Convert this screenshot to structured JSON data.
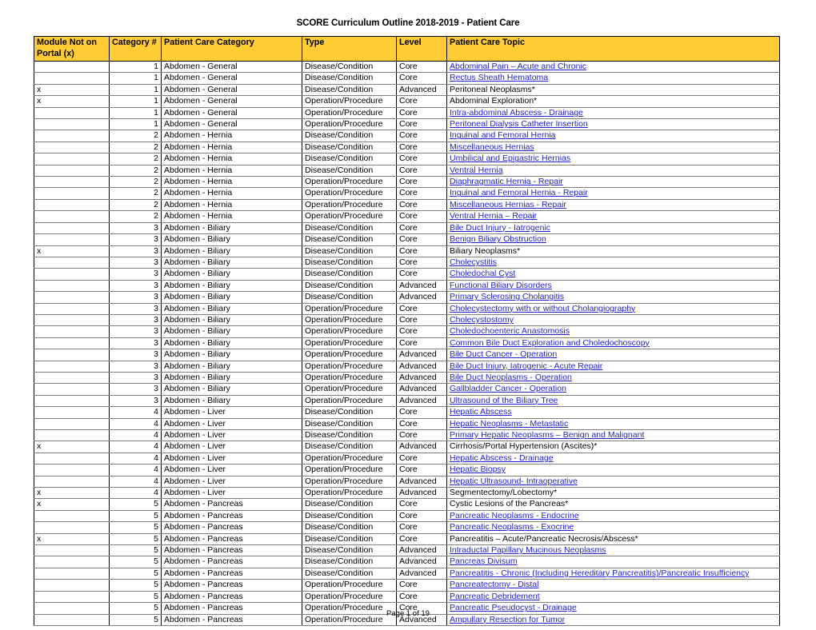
{
  "document": {
    "title": "SCORE Curriculum Outline 2018-2019 - Patient Care",
    "footer": "Page 1 of 19",
    "header_bg_color": "#FFCC33",
    "link_color": "#2222CC"
  },
  "table": {
    "columns": [
      {
        "key": "module_not_on_portal",
        "label": "Module Not on Portal (x)"
      },
      {
        "key": "category_number",
        "label": "Category #"
      },
      {
        "key": "patient_care_category",
        "label": "Patient Care Category"
      },
      {
        "key": "type",
        "label": "Type"
      },
      {
        "key": "level",
        "label": "Level"
      },
      {
        "key": "patient_care_topic",
        "label": "Patient Care Topic"
      }
    ],
    "rows": [
      {
        "mod": "",
        "cat": "1",
        "category": "Abdomen - General",
        "type": "Disease/Condition",
        "level": "Core",
        "topic": "Abdominal Pain – Acute and Chronic",
        "link": true
      },
      {
        "mod": "",
        "cat": "1",
        "category": "Abdomen - General",
        "type": "Disease/Condition",
        "level": "Core",
        "topic": "Rectus Sheath Hematoma",
        "link": true
      },
      {
        "mod": "x",
        "cat": "1",
        "category": "Abdomen - General",
        "type": "Disease/Condition",
        "level": "Advanced",
        "topic": "Peritoneal Neoplasms*",
        "link": false
      },
      {
        "mod": "x",
        "cat": "1",
        "category": "Abdomen - General",
        "type": "Operation/Procedure",
        "level": "Core",
        "topic": "Abdominal Exploration*",
        "link": false
      },
      {
        "mod": "",
        "cat": "1",
        "category": "Abdomen - General",
        "type": "Operation/Procedure",
        "level": "Core",
        "topic": "Intra-abdominal Abscess - Drainage",
        "link": true
      },
      {
        "mod": "",
        "cat": "1",
        "category": "Abdomen - General",
        "type": "Operation/Procedure",
        "level": "Core",
        "topic": "Peritoneal Dialysis Catheter Insertion",
        "link": true
      },
      {
        "mod": "",
        "cat": "2",
        "category": "Abdomen - Hernia",
        "type": "Disease/Condition",
        "level": "Core",
        "topic": "Inguinal and Femoral Hernia",
        "link": true
      },
      {
        "mod": "",
        "cat": "2",
        "category": "Abdomen - Hernia",
        "type": "Disease/Condition",
        "level": "Core",
        "topic": "Miscellaneous Hernias",
        "link": true
      },
      {
        "mod": "",
        "cat": "2",
        "category": "Abdomen - Hernia",
        "type": "Disease/Condition",
        "level": "Core",
        "topic": "Umbilical and Epigastric Hernias",
        "link": true
      },
      {
        "mod": "",
        "cat": "2",
        "category": "Abdomen - Hernia",
        "type": "Disease/Condition",
        "level": "Core",
        "topic": "Ventral Hernia",
        "link": true
      },
      {
        "mod": "",
        "cat": "2",
        "category": "Abdomen - Hernia",
        "type": "Operation/Procedure",
        "level": "Core",
        "topic": "Diaphragmatic Hernia - Repair",
        "link": true
      },
      {
        "mod": "",
        "cat": "2",
        "category": "Abdomen - Hernia",
        "type": "Operation/Procedure",
        "level": "Core",
        "topic": "Inguinal and Femoral Hernia - Repair",
        "link": true
      },
      {
        "mod": "",
        "cat": "2",
        "category": "Abdomen - Hernia",
        "type": "Operation/Procedure",
        "level": "Core",
        "topic": "Miscellaneous Hernias - Repair",
        "link": true
      },
      {
        "mod": "",
        "cat": "2",
        "category": "Abdomen - Hernia",
        "type": "Operation/Procedure",
        "level": "Core",
        "topic": "Ventral Hernia – Repair",
        "link": true
      },
      {
        "mod": "",
        "cat": "3",
        "category": "Abdomen - Biliary",
        "type": "Disease/Condition",
        "level": "Core",
        "topic": "Bile Duct Injury - Iatrogenic",
        "link": true
      },
      {
        "mod": "",
        "cat": "3",
        "category": "Abdomen - Biliary",
        "type": "Disease/Condition",
        "level": "Core",
        "topic": "Benign Biliary Obstruction",
        "link": true
      },
      {
        "mod": "x",
        "cat": "3",
        "category": "Abdomen - Biliary",
        "type": "Disease/Condition",
        "level": "Core",
        "topic": "Biliary Neoplasms*",
        "link": false
      },
      {
        "mod": "",
        "cat": "3",
        "category": "Abdomen - Biliary",
        "type": "Disease/Condition",
        "level": "Core",
        "topic": "Cholecystitis",
        "link": true
      },
      {
        "mod": "",
        "cat": "3",
        "category": "Abdomen - Biliary",
        "type": "Disease/Condition",
        "level": "Core",
        "topic": "Choledochal Cyst",
        "link": true
      },
      {
        "mod": "",
        "cat": "3",
        "category": "Abdomen - Biliary",
        "type": "Disease/Condition",
        "level": "Advanced",
        "topic": "Functional Biliary Disorders",
        "link": true
      },
      {
        "mod": "",
        "cat": "3",
        "category": "Abdomen - Biliary",
        "type": "Disease/Condition",
        "level": "Advanced",
        "topic": "Primary Sclerosing Cholangitis",
        "link": true
      },
      {
        "mod": "",
        "cat": "3",
        "category": "Abdomen - Biliary",
        "type": "Operation/Procedure",
        "level": "Core",
        "topic": "Cholecystectomy with or without Cholangiography",
        "link": true
      },
      {
        "mod": "",
        "cat": "3",
        "category": "Abdomen - Biliary",
        "type": "Operation/Procedure",
        "level": "Core",
        "topic": "Cholecystostomy",
        "link": true
      },
      {
        "mod": "",
        "cat": "3",
        "category": "Abdomen - Biliary",
        "type": "Operation/Procedure",
        "level": "Core",
        "topic": "Choledochoenteric Anastomosis",
        "link": true
      },
      {
        "mod": "",
        "cat": "3",
        "category": "Abdomen - Biliary",
        "type": "Operation/Procedure",
        "level": "Core",
        "topic": "Common Bile Duct Exploration and Choledochoscopy",
        "link": true
      },
      {
        "mod": "",
        "cat": "3",
        "category": "Abdomen - Biliary",
        "type": "Operation/Procedure",
        "level": "Advanced",
        "topic": "Bile Duct Cancer - Operation",
        "link": true
      },
      {
        "mod": "",
        "cat": "3",
        "category": "Abdomen - Biliary",
        "type": "Operation/Procedure",
        "level": "Advanced",
        "topic": "Bile Duct Injury, Iatrogenic - Acute Repair",
        "link": true
      },
      {
        "mod": "",
        "cat": "3",
        "category": "Abdomen - Biliary",
        "type": "Operation/Procedure",
        "level": "Advanced",
        "topic": "Bile Duct Neoplasms - Operation",
        "link": true
      },
      {
        "mod": "",
        "cat": "3",
        "category": "Abdomen - Biliary",
        "type": "Operation/Procedure",
        "level": "Advanced",
        "topic": "Gallbladder Cancer - Operation",
        "link": true
      },
      {
        "mod": "",
        "cat": "3",
        "category": "Abdomen - Biliary",
        "type": "Operation/Procedure",
        "level": "Advanced",
        "topic": "Ultrasound of the Biliary Tree",
        "link": true
      },
      {
        "mod": "",
        "cat": "4",
        "category": "Abdomen - Liver",
        "type": "Disease/Condition",
        "level": "Core",
        "topic": "Hepatic Abscess",
        "link": true
      },
      {
        "mod": "",
        "cat": "4",
        "category": "Abdomen - Liver",
        "type": "Disease/Condition",
        "level": "Core",
        "topic": "Hepatic Neoplasms - Metastatic",
        "link": true
      },
      {
        "mod": "",
        "cat": "4",
        "category": "Abdomen - Liver",
        "type": "Disease/Condition",
        "level": "Core",
        "topic": "Primary Hepatic Neoplasms – Benign and Malignant",
        "link": true
      },
      {
        "mod": "x",
        "cat": "4",
        "category": "Abdomen - Liver",
        "type": "Disease/Condition",
        "level": "Advanced",
        "topic": "Cirrhosis/Portal Hypertension (Ascites)*",
        "link": false
      },
      {
        "mod": "",
        "cat": "4",
        "category": "Abdomen - Liver",
        "type": "Operation/Procedure",
        "level": "Core",
        "topic": "Hepatic Abscess - Drainage",
        "link": true
      },
      {
        "mod": "",
        "cat": "4",
        "category": "Abdomen - Liver",
        "type": "Operation/Procedure",
        "level": "Core",
        "topic": "Hepatic Biopsy",
        "link": true
      },
      {
        "mod": "",
        "cat": "4",
        "category": "Abdomen - Liver",
        "type": "Operation/Procedure",
        "level": "Advanced",
        "topic": "Hepatic Ultrasound- Intraoperative",
        "link": true
      },
      {
        "mod": "x",
        "cat": "4",
        "category": "Abdomen - Liver",
        "type": "Operation/Procedure",
        "level": "Advanced",
        "topic": "Segmentectomy/Lobectomy*",
        "link": false
      },
      {
        "mod": "x",
        "cat": "5",
        "category": "Abdomen - Pancreas",
        "type": "Disease/Condition",
        "level": "Core",
        "topic": "Cystic Lesions of the Pancreas*",
        "link": false
      },
      {
        "mod": "",
        "cat": "5",
        "category": "Abdomen - Pancreas",
        "type": "Disease/Condition",
        "level": "Core",
        "topic": "Pancreatic Neoplasms - Endocrine",
        "link": true
      },
      {
        "mod": "",
        "cat": "5",
        "category": "Abdomen - Pancreas",
        "type": "Disease/Condition",
        "level": "Core",
        "topic": "Pancreatic Neoplasms - Exocrine",
        "link": true
      },
      {
        "mod": "x",
        "cat": "5",
        "category": "Abdomen - Pancreas",
        "type": "Disease/Condition",
        "level": "Core",
        "topic": "Pancreatitis – Acute/Pancreatic Necrosis/Abscess*",
        "link": false
      },
      {
        "mod": "",
        "cat": "5",
        "category": "Abdomen - Pancreas",
        "type": "Disease/Condition",
        "level": "Advanced",
        "topic": "Intraductal Papillary Mucinous Neoplasms",
        "link": true
      },
      {
        "mod": "",
        "cat": "5",
        "category": "Abdomen - Pancreas",
        "type": "Disease/Condition",
        "level": "Advanced",
        "topic": "Pancreas Divisum",
        "link": true
      },
      {
        "mod": "",
        "cat": "5",
        "category": "Abdomen - Pancreas",
        "type": "Disease/Condition",
        "level": "Advanced",
        "topic": "Pancreatitis - Chronic (Including Hereditary Pancreatitis)/Pancreatic Insufficiency",
        "link": true
      },
      {
        "mod": "",
        "cat": "5",
        "category": "Abdomen - Pancreas",
        "type": "Operation/Procedure",
        "level": "Core",
        "topic": "Pancreatectomy - Distal",
        "link": true
      },
      {
        "mod": "",
        "cat": "5",
        "category": "Abdomen - Pancreas",
        "type": "Operation/Procedure",
        "level": "Core",
        "topic": "Pancreatic Debridement",
        "link": true
      },
      {
        "mod": "",
        "cat": "5",
        "category": "Abdomen - Pancreas",
        "type": "Operation/Procedure",
        "level": "Core",
        "topic": "Pancreatic Pseudocyst - Drainage",
        "link": true
      },
      {
        "mod": "",
        "cat": "5",
        "category": "Abdomen - Pancreas",
        "type": "Operation/Procedure",
        "level": "Advanced",
        "topic": "Ampullary Resection for Tumor",
        "link": true
      }
    ]
  }
}
